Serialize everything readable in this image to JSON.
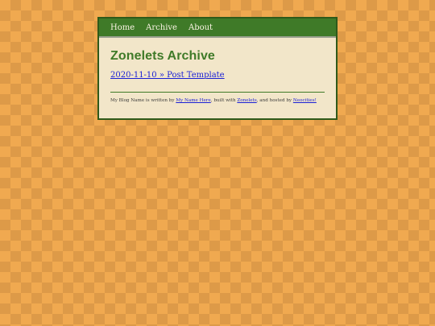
{
  "nav": {
    "items": [
      {
        "label": "Home"
      },
      {
        "label": "Archive"
      },
      {
        "label": "About"
      }
    ]
  },
  "page": {
    "title": "Zonelets Archive"
  },
  "posts": [
    {
      "label": "2020-11-10 » Post Template"
    }
  ],
  "footer": {
    "text_1": "My Blog Name is written by ",
    "author_link": "My Name Here",
    "text_2": ", built with ",
    "builder_link": "Zonelets",
    "text_3": ", and hosted by ",
    "host_link": "Neocities!"
  },
  "colors": {
    "accent": "#3f7a28",
    "link": "#1a20d6",
    "panel": "#f2e6c9",
    "background": "#f0a950"
  }
}
